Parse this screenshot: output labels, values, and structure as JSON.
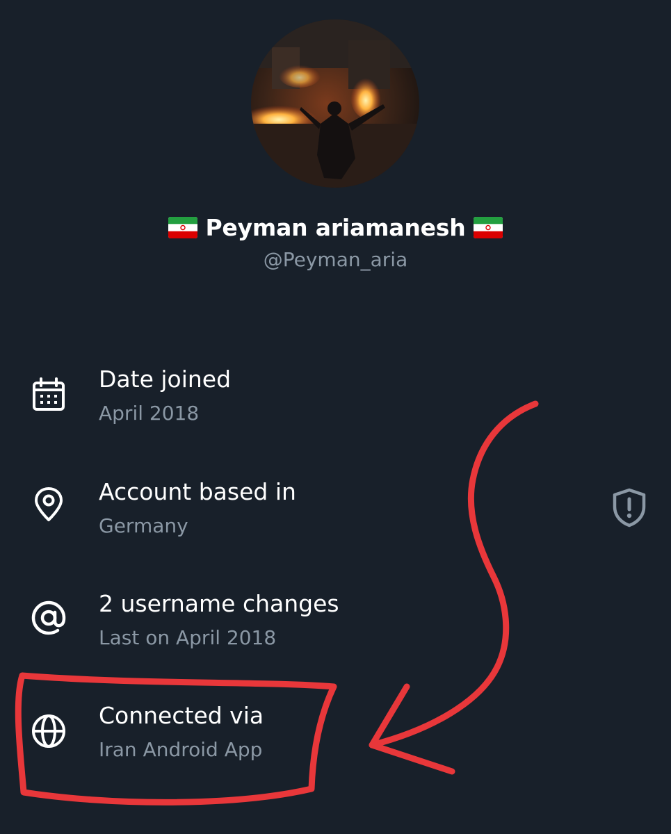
{
  "profile": {
    "display_name": "Peyman ariamanesh",
    "handle": "@Peyman_aria",
    "name_flag_icon": "iran-flag-icon"
  },
  "details": [
    {
      "icon": "calendar-icon",
      "title": "Date joined",
      "subtitle": "April 2018"
    },
    {
      "icon": "location-pin-icon",
      "title": "Account based in",
      "subtitle": "Germany"
    },
    {
      "icon": "at-sign-icon",
      "title": "2 username changes",
      "subtitle": "Last on April 2018"
    },
    {
      "icon": "globe-icon",
      "title": "Connected via",
      "subtitle": "Iran Android App"
    }
  ],
  "side_icon": "shield-alert-icon",
  "colors": {
    "background": "#18202a",
    "primary_text": "#ffffff",
    "secondary_text": "#8b98a5",
    "annotation": "#e8373a"
  }
}
